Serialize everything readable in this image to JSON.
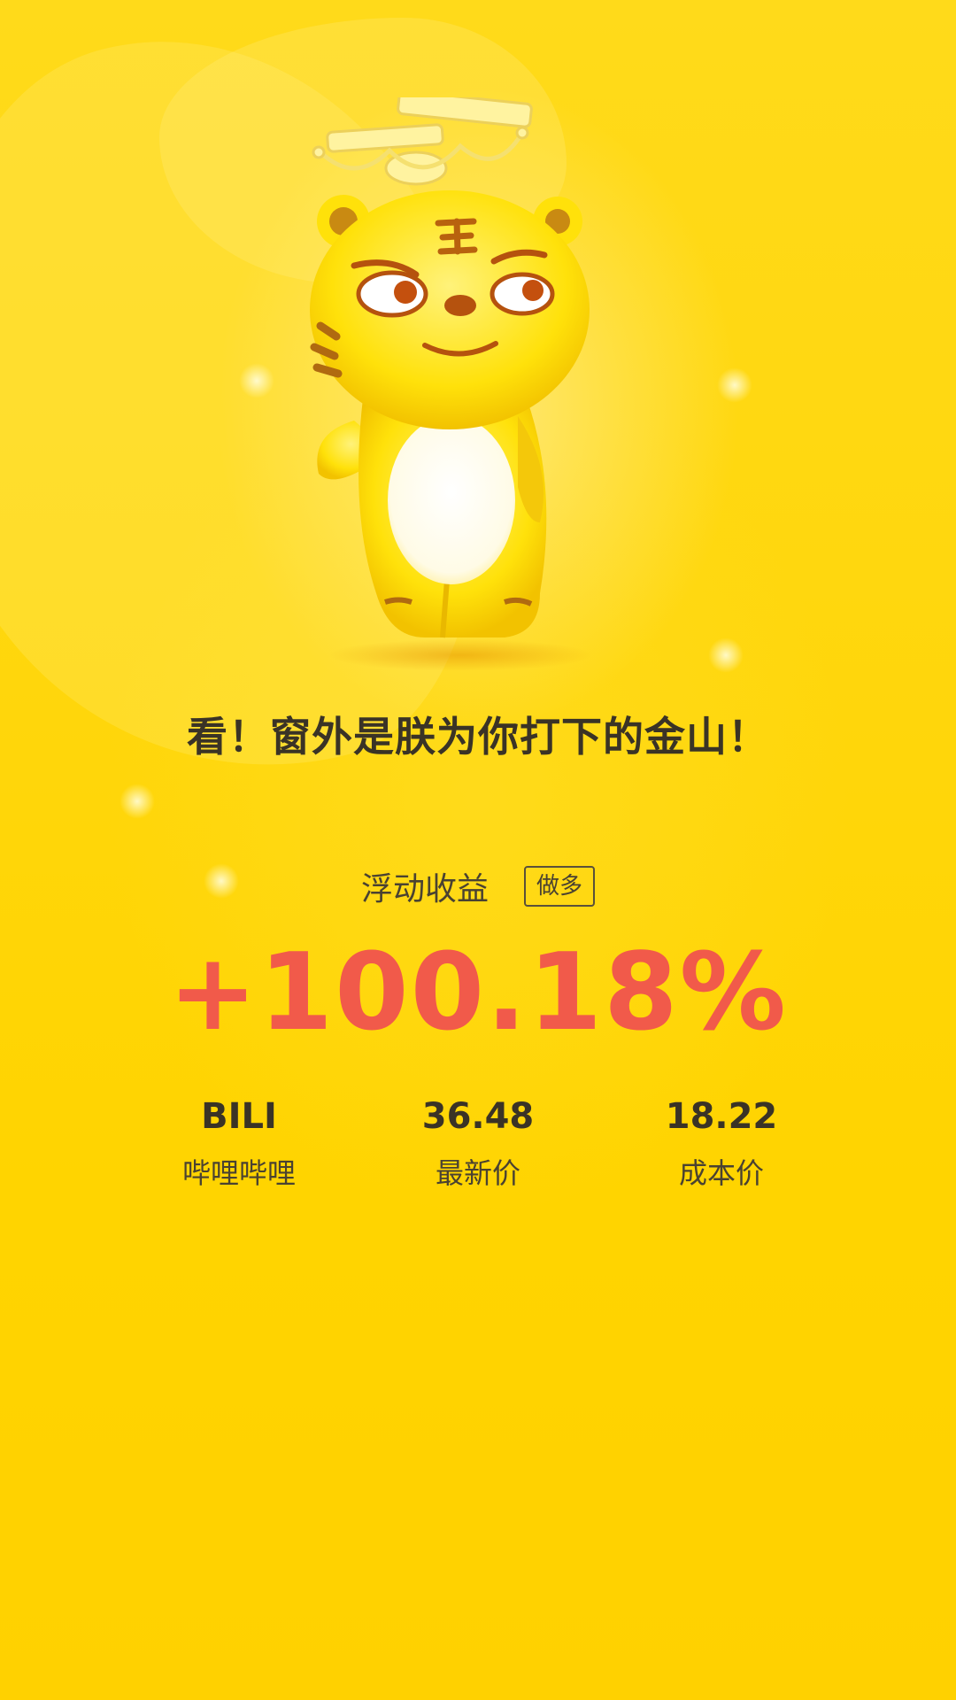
{
  "headline": "看！窗外是朕为你打下的金山！",
  "pnl": {
    "label": "浮动收益",
    "tag": "做多",
    "value": "+100.18%"
  },
  "stats": [
    {
      "value": "BILI",
      "label": "哔哩哔哩"
    },
    {
      "value": "36.48",
      "label": "最新价"
    },
    {
      "value": "18.22",
      "label": "成本价"
    }
  ],
  "colors": {
    "background": "#ffd400",
    "profit": "#f15a4a",
    "text": "#3a3326"
  },
  "icons": {
    "mascot": "tiger-mascot-icon"
  }
}
